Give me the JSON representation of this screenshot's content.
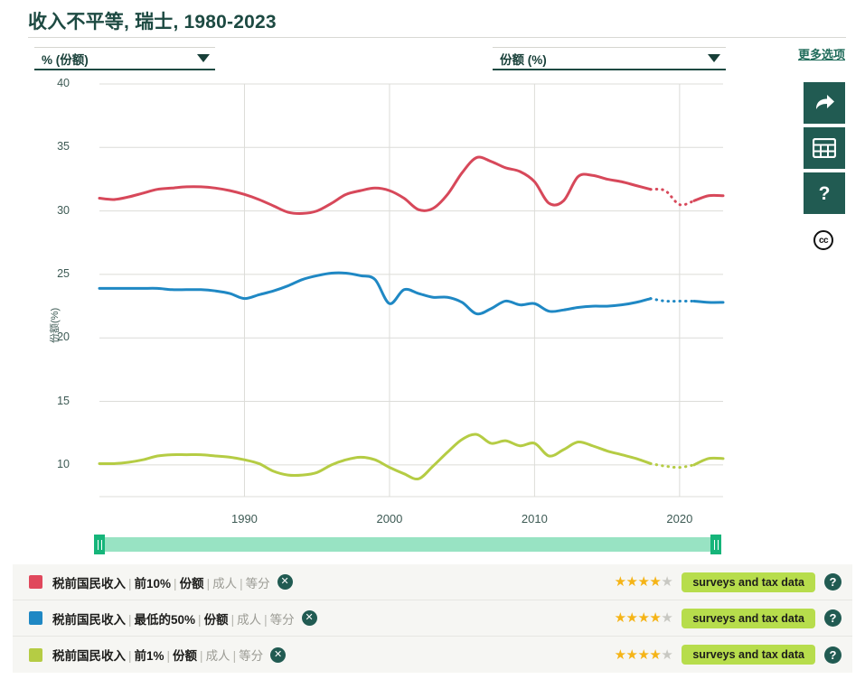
{
  "header": {
    "title": "收入不平等, 瑞士, 1980-2023",
    "more_options_label": "更多选项"
  },
  "controls": {
    "select_left": {
      "value": "% (份额)",
      "icon": "chevron-down-icon"
    },
    "select_right": {
      "value": "份额 (%)",
      "icon": "chevron-down-icon"
    }
  },
  "side_buttons": [
    {
      "name": "share-button",
      "icon": "share-arrow-icon"
    },
    {
      "name": "table-button",
      "icon": "table-grid-icon"
    },
    {
      "name": "help-button",
      "icon": "question-mark-icon"
    }
  ],
  "license": {
    "label": "cc",
    "icon": "creative-commons-icon"
  },
  "legend": {
    "rows": [
      {
        "color": "#e0485c",
        "parts": [
          "税前国民收入",
          "前10%",
          "份额"
        ],
        "dim_parts": [
          "成人",
          "等分"
        ],
        "separator": "|",
        "close_label": "✕",
        "stars_filled": 4,
        "stars_total": 5,
        "source_badge": "surveys and tax data",
        "help_label": "?"
      },
      {
        "color": "#1f88c4",
        "parts": [
          "税前国民收入",
          "最低的50%",
          "份额"
        ],
        "dim_parts": [
          "成人",
          "等分"
        ],
        "separator": "|",
        "close_label": "✕",
        "stars_filled": 4,
        "stars_total": 5,
        "source_badge": "surveys and tax data",
        "help_label": "?"
      },
      {
        "color": "#b5cc44",
        "parts": [
          "税前国民收入",
          "前1%",
          "份额"
        ],
        "dim_parts": [
          "成人",
          "等分"
        ],
        "separator": "|",
        "close_label": "✕",
        "stars_filled": 4,
        "stars_total": 5,
        "source_badge": "surveys and tax data",
        "help_label": "?"
      }
    ]
  },
  "range_slider": {
    "start_year": 1980,
    "end_year": 2023
  },
  "chart_data": {
    "type": "line",
    "title": "收入不平等, 瑞士, 1980-2023",
    "xlabel": "",
    "ylabel": "份额(%)",
    "xlim": [
      1980,
      2023
    ],
    "ylim": [
      7.5,
      40
    ],
    "yticks": [
      10,
      15,
      20,
      25,
      30,
      35,
      40
    ],
    "xticks": [
      1990,
      2000,
      2010,
      2020
    ],
    "grid": true,
    "legend_position": "below-chart",
    "projection_start_year": 2018,
    "x": [
      1980,
      1981,
      1982,
      1983,
      1984,
      1985,
      1986,
      1987,
      1988,
      1989,
      1990,
      1991,
      1992,
      1993,
      1994,
      1995,
      1996,
      1997,
      1998,
      1999,
      2000,
      2001,
      2002,
      2003,
      2004,
      2005,
      2006,
      2007,
      2008,
      2009,
      2010,
      2011,
      2012,
      2013,
      2014,
      2015,
      2016,
      2017,
      2018,
      2019,
      2020,
      2021,
      2022,
      2023
    ],
    "series": [
      {
        "name": "税前国民收入 | 前10% | 份额 | 成人 | 等分",
        "color": "#d7485a",
        "values": [
          31.0,
          30.9,
          31.1,
          31.4,
          31.7,
          31.8,
          31.9,
          31.9,
          31.8,
          31.6,
          31.3,
          30.9,
          30.4,
          29.9,
          29.8,
          30.0,
          30.6,
          31.3,
          31.6,
          31.8,
          31.6,
          31.0,
          30.1,
          30.2,
          31.3,
          33.0,
          34.2,
          33.9,
          33.4,
          33.1,
          32.3,
          30.6,
          30.8,
          32.7,
          32.8,
          32.5,
          32.3,
          32.0,
          31.7,
          31.6,
          30.5,
          30.8,
          31.2,
          31.2
        ]
      },
      {
        "name": "税前国民收入 | 最低的50% | 份额 | 成人 | 等分",
        "color": "#1f88c4",
        "values": [
          23.9,
          23.9,
          23.9,
          23.9,
          23.9,
          23.8,
          23.8,
          23.8,
          23.7,
          23.5,
          23.1,
          23.4,
          23.7,
          24.1,
          24.6,
          24.9,
          25.1,
          25.1,
          24.9,
          24.6,
          22.7,
          23.8,
          23.5,
          23.2,
          23.2,
          22.8,
          21.9,
          22.3,
          22.9,
          22.6,
          22.7,
          22.1,
          22.2,
          22.4,
          22.5,
          22.5,
          22.6,
          22.8,
          23.1,
          22.9,
          22.9,
          22.9,
          22.8,
          22.8
        ]
      },
      {
        "name": "税前国民收入 | 前1% | 份额 | 成人 | 等分",
        "color": "#b5cc44",
        "values": [
          10.1,
          10.1,
          10.2,
          10.4,
          10.7,
          10.8,
          10.8,
          10.8,
          10.7,
          10.6,
          10.4,
          10.1,
          9.5,
          9.2,
          9.2,
          9.4,
          10.0,
          10.4,
          10.6,
          10.4,
          9.8,
          9.3,
          8.9,
          9.9,
          11.0,
          12.0,
          12.4,
          11.7,
          11.9,
          11.5,
          11.7,
          10.7,
          11.2,
          11.8,
          11.5,
          11.1,
          10.8,
          10.5,
          10.1,
          9.9,
          9.8,
          10.0,
          10.5,
          10.5
        ]
      }
    ]
  }
}
